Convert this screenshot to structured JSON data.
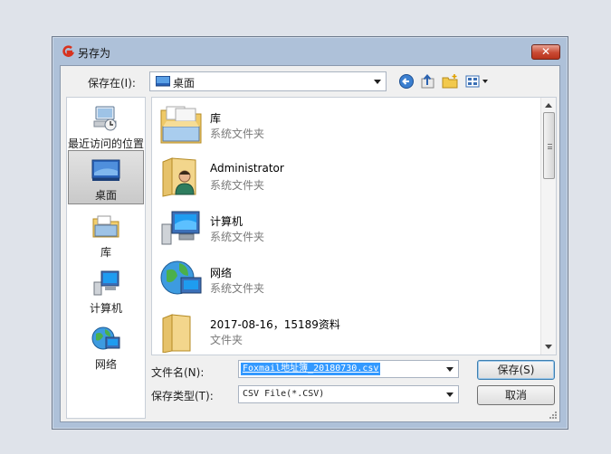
{
  "window": {
    "title": "另存为",
    "close_label": "✕"
  },
  "toolbar": {
    "save_in_label": "保存在(I):",
    "save_in_value": "桌面",
    "back_icon": "back-arrow-icon",
    "up_icon": "up-folder-icon",
    "new_folder_icon": "new-folder-icon",
    "view_icon": "view-menu-icon"
  },
  "places": [
    {
      "label": "最近访问的位置",
      "icon": "recent-places-icon"
    },
    {
      "label": "桌面",
      "icon": "desktop-icon",
      "selected": true
    },
    {
      "label": "库",
      "icon": "libraries-icon"
    },
    {
      "label": "计算机",
      "icon": "computer-icon"
    },
    {
      "label": "网络",
      "icon": "network-icon"
    }
  ],
  "files": [
    {
      "name": "库",
      "type": "系统文件夹",
      "icon": "libraries-folder-icon"
    },
    {
      "name": "Administrator",
      "type": "系统文件夹",
      "icon": "user-folder-icon"
    },
    {
      "name": "计算机",
      "type": "系统文件夹",
      "icon": "computer-icon"
    },
    {
      "name": "网络",
      "type": "系统文件夹",
      "icon": "network-icon"
    },
    {
      "name": "2017-08-16，15189资料",
      "type": "文件夹",
      "icon": "folder-icon"
    }
  ],
  "form": {
    "filename_label": "文件名(N):",
    "filename_value": "Foxmail地址簿_20180730.csv",
    "filetype_label": "保存类型(T):",
    "filetype_value": "CSV File(*.CSV)"
  },
  "buttons": {
    "save": "保存(S)",
    "cancel": "取消"
  },
  "colors": {
    "accent_selection": "#3399ff",
    "close_button": "#c94a33"
  }
}
